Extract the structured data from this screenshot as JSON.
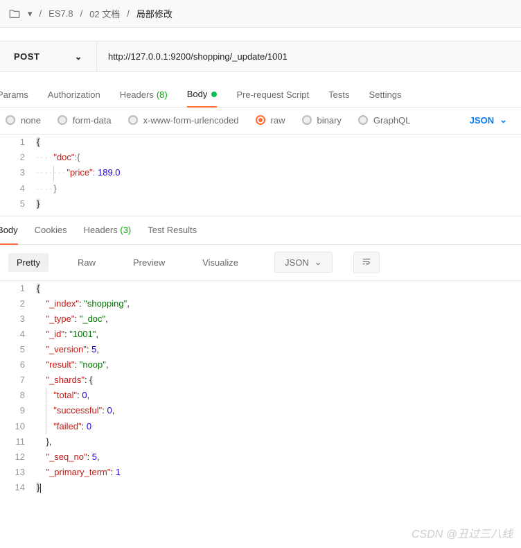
{
  "breadcrumb": {
    "items": [
      "ES7.8",
      "02 文档",
      "局部修改"
    ],
    "sep": "/"
  },
  "request": {
    "method": "POST",
    "url": "http://127.0.0.1:9200/shopping/_update/1001"
  },
  "tabs_req": {
    "params": "Params",
    "auth": "Authorization",
    "headers": "Headers",
    "headers_count": "(8)",
    "body": "Body",
    "prereq": "Pre-request Script",
    "tests": "Tests",
    "settings": "Settings"
  },
  "body_types": {
    "none": "none",
    "form": "form-data",
    "xwww": "x-www-form-urlencoded",
    "raw": "raw",
    "binary": "binary",
    "graphql": "GraphQL",
    "lang": "JSON"
  },
  "body_editor": {
    "lines": [
      "1",
      "2",
      "3",
      "4",
      "5"
    ],
    "k_doc": "\"doc\"",
    "k_price": "\"price\"",
    "v_price": "189.0"
  },
  "tabs_resp": {
    "body": "Body",
    "cookies": "Cookies",
    "headers": "Headers",
    "headers_count": "(3)",
    "results": "Test Results"
  },
  "view": {
    "pretty": "Pretty",
    "raw": "Raw",
    "preview": "Preview",
    "visualize": "Visualize",
    "type": "JSON"
  },
  "response": {
    "lines": [
      "1",
      "2",
      "3",
      "4",
      "5",
      "6",
      "7",
      "8",
      "9",
      "10",
      "11",
      "12",
      "13",
      "14"
    ],
    "k_index": "\"_index\"",
    "v_index": "\"shopping\"",
    "k_type": "\"_type\"",
    "v_type": "\"_doc\"",
    "k_id": "\"_id\"",
    "v_id": "\"1001\"",
    "k_version": "\"_version\"",
    "v_version": "5",
    "k_result": "\"result\"",
    "v_result": "\"noop\"",
    "k_shards": "\"_shards\"",
    "k_total": "\"total\"",
    "v_total": "0",
    "k_successful": "\"successful\"",
    "v_successful": "0",
    "k_failed": "\"failed\"",
    "v_failed": "0",
    "k_seqno": "\"_seq_no\"",
    "v_seqno": "5",
    "k_primary": "\"_primary_term\"",
    "v_primary": "1"
  },
  "watermark": "CSDN @丑过三八线"
}
